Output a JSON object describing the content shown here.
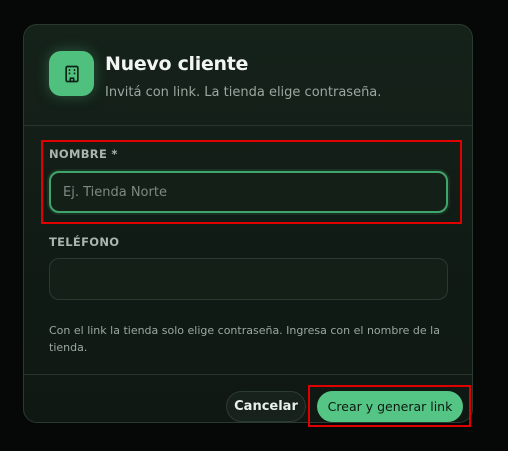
{
  "dialog": {
    "title": "Nuevo cliente",
    "subtitle": "Invitá con link. La tienda elige contraseña.",
    "icon": "store-icon",
    "accent_color": "#4fc07e"
  },
  "form": {
    "name": {
      "label": "NOMBRE *",
      "placeholder": "Ej. Tienda Norte",
      "value": ""
    },
    "phone": {
      "label": "TELÉFONO",
      "placeholder": "",
      "value": ""
    },
    "hint": "Con el link la tienda solo elige contraseña. Ingresa con el nombre de la tienda."
  },
  "footer": {
    "cancel_label": "Cancelar",
    "create_label": "Crear y generar link"
  },
  "highlight_color": "#e00000"
}
